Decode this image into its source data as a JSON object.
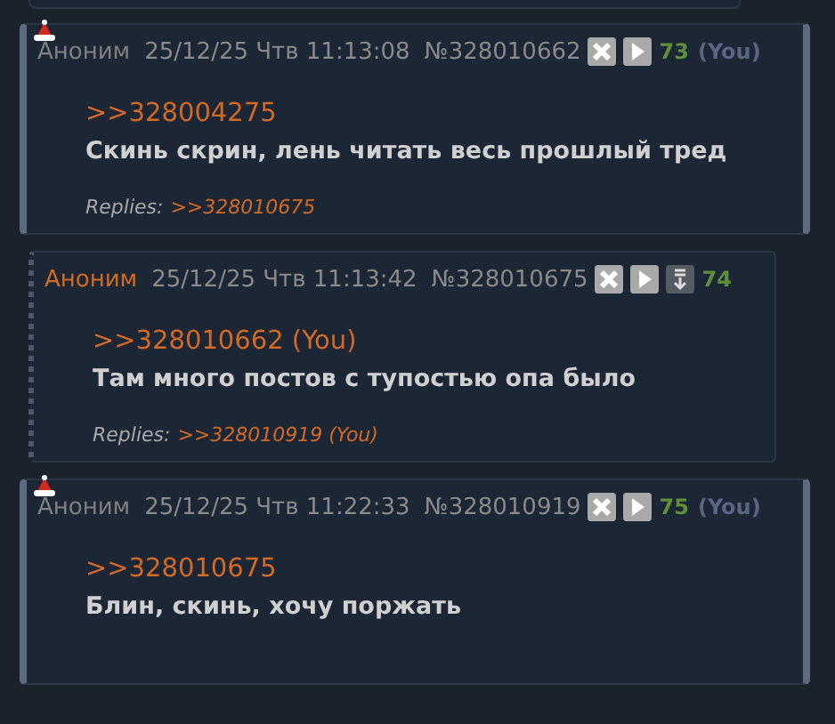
{
  "posts": [
    {
      "own": true,
      "name": "Аноним",
      "date": "25/12/25 Чтв 11:13:08",
      "number": "№328010662",
      "buttons": [
        {
          "kind": "hide"
        },
        {
          "kind": "play"
        }
      ],
      "count": "73",
      "you": "(You)",
      "quote": ">>328004275",
      "text": "Скинь скрин, лень читать весь прошлый тред",
      "replies_label": "Replies:",
      "replies": [
        ">>328010675"
      ]
    },
    {
      "own": false,
      "name": "Аноним",
      "date": "25/12/25 Чтв 11:13:42",
      "number": "№328010675",
      "buttons": [
        {
          "kind": "hide"
        },
        {
          "kind": "play"
        },
        {
          "kind": "download"
        }
      ],
      "count": "74",
      "quote": ">>328010662 (You)",
      "text": "Там много постов с тупостью опа было",
      "replies_label": "Replies:",
      "replies": [
        ">>328010919 (You)"
      ]
    },
    {
      "own": true,
      "name": "Аноним",
      "date": "25/12/25 Чтв 11:22:33",
      "number": "№328010919",
      "buttons": [
        {
          "kind": "hide"
        },
        {
          "kind": "play"
        }
      ],
      "count": "75",
      "you": "(You)",
      "quote": ">>328010675",
      "text": "Блин, скинь, хочу поржать"
    }
  ]
}
